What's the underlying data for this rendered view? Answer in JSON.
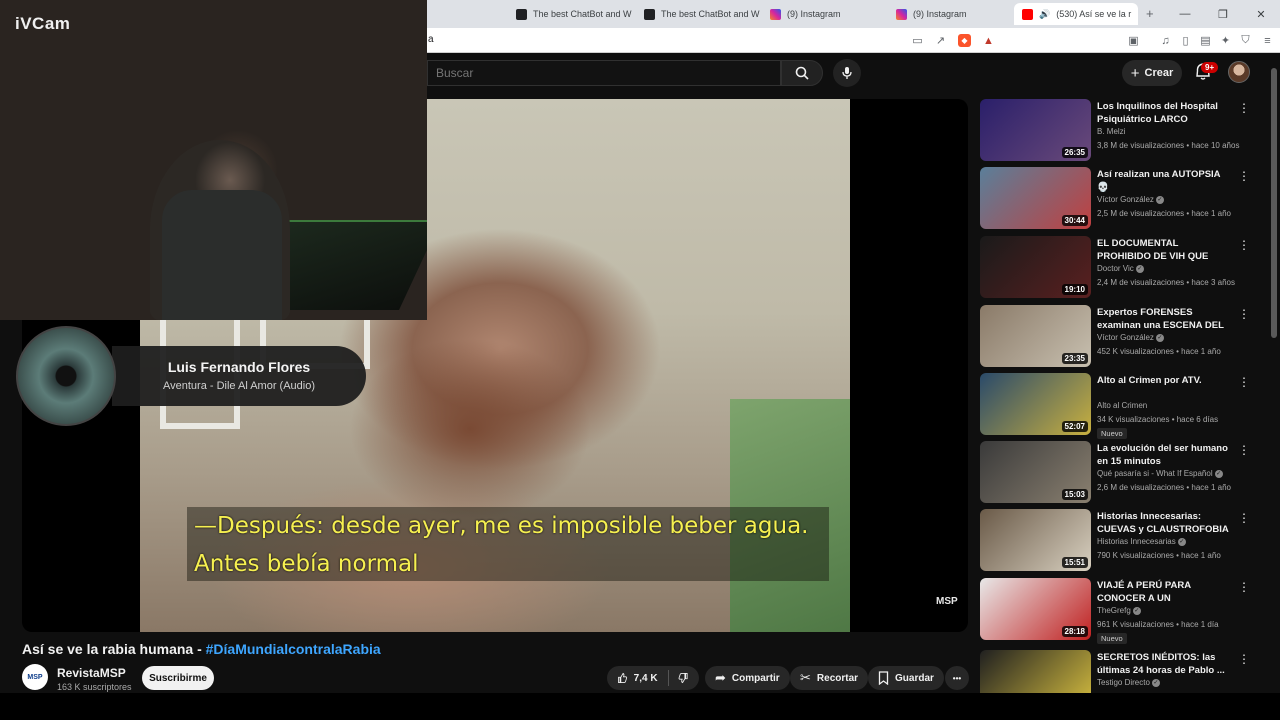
{
  "browser": {
    "tabs": [
      {
        "title": "The best ChatBot and Wi",
        "favicon_color": "#202124"
      },
      {
        "title": "The best ChatBot and Wi",
        "favicon_color": "#202124"
      },
      {
        "title": "(9) Instagram",
        "favicon_color": "#d6249f"
      },
      {
        "title": "(9) Instagram",
        "favicon_color": "#d6249f"
      },
      {
        "title": "(530) Así se ve la r",
        "favicon_color": "#ff0000"
      }
    ],
    "url": "a",
    "new_tab": "+",
    "close": "×"
  },
  "webcam": {
    "label": "iVCam"
  },
  "music_overlay": {
    "title": "Luis Fernando Flores",
    "subtitle": "Aventura - Dile Al Amor (Audio)"
  },
  "header": {
    "search_placeholder": "Buscar",
    "create_label": "Crear",
    "notifications_badge": "9+"
  },
  "video": {
    "subtitle_line1": "—Después: desde ayer, me es imposible beber agua.",
    "subtitle_line2": "Antes bebía normal",
    "watermark": "MSP",
    "title_main": "Así se ve la rabia humana - ",
    "title_tag": "#DíaMundialcontralaRabia",
    "channel_name": "RevistaMSP",
    "channel_subs": "163 K suscriptores",
    "channel_avatar_text": "MSP",
    "subscribe_label": "Suscribirme",
    "likes": "7,4 K",
    "share_label": "Compartir",
    "clip_label": "Recortar",
    "save_label": "Guardar",
    "more_label": "•••"
  },
  "recommendations": [
    {
      "title": "Los Inquilinos del Hospital Psiquiátrico LARCO HERRERA ...",
      "channel": "B. Melzi",
      "verified": false,
      "meta": "3,8 M de visualizaciones • hace 10 años",
      "duration": "26:35",
      "badge": "",
      "thumb_colors": [
        "#2a1f6a",
        "#6a4a7a"
      ]
    },
    {
      "title": "Así realizan una AUTOPSIA 💀",
      "channel": "Víctor González",
      "verified": true,
      "meta": "2,5 M de visualizaciones • hace 1 año",
      "duration": "30:44",
      "badge": "",
      "thumb_colors": [
        "#5a7f9a",
        "#c04040"
      ]
    },
    {
      "title": "EL DOCUMENTAL PROHIBIDO DE VIH QUE ATERRORIZÓ A L...",
      "channel": "Doctor Vic",
      "verified": true,
      "meta": "2,4 M de visualizaciones • hace 3 años",
      "duration": "19:10",
      "badge": "",
      "thumb_colors": [
        "#1a1a1a",
        "#5a2020"
      ]
    },
    {
      "title": "Expertos FORENSES examinan una ESCENA DEL CRIMEN...",
      "channel": "Víctor González",
      "verified": true,
      "meta": "452 K visualizaciones • hace 1 año",
      "duration": "23:35",
      "badge": "",
      "thumb_colors": [
        "#8a7a68",
        "#c8c0b0"
      ]
    },
    {
      "title": "Alto al Crimen por ATV.",
      "channel": "Alto al Crimen",
      "verified": false,
      "meta": "34 K visualizaciones • hace 6 días",
      "duration": "52:07",
      "badge": "Nuevo",
      "thumb_colors": [
        "#2a4a6a",
        "#c8b040"
      ]
    },
    {
      "title": "La evolución del ser humano en 15 minutos",
      "channel": "Qué pasaría si - What If Español",
      "verified": true,
      "meta": "2,6 M de visualizaciones • hace 1 año",
      "duration": "15:03",
      "badge": "",
      "thumb_colors": [
        "#3a3a3a",
        "#8a8070"
      ]
    },
    {
      "title": "Historias Innecesarias: CUEVAS y CLAUSTROFOBIA",
      "channel": "Historias Innecesarias",
      "verified": true,
      "meta": "790 K visualizaciones • hace 1 año",
      "duration": "15:51",
      "badge": "",
      "thumb_colors": [
        "#6a5a48",
        "#d8d0c0"
      ]
    },
    {
      "title": "VIAJÉ A PERÚ PARA CONOCER A UN SUSCRIPTOR",
      "channel": "TheGrefg",
      "verified": true,
      "meta": "961 K visualizaciones • hace 1 día",
      "duration": "28:18",
      "badge": "Nuevo",
      "thumb_colors": [
        "#e8e8e8",
        "#c02020"
      ]
    },
    {
      "title": "SECRETOS INÉDITOS: las últimas 24 horas de Pablo ...",
      "channel": "Testigo Directo",
      "verified": true,
      "meta": "",
      "duration": "",
      "badge": "",
      "thumb_colors": [
        "#202020",
        "#d8c040"
      ]
    }
  ]
}
